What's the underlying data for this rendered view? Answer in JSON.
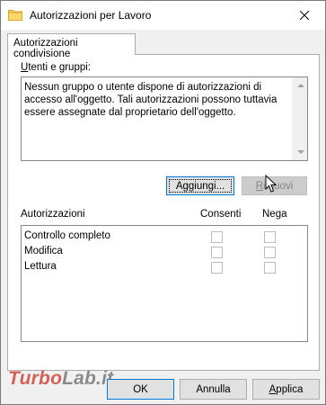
{
  "window": {
    "title": "Autorizzazioni per Lavoro"
  },
  "tab": {
    "label": "Autorizzazioni condivisione"
  },
  "users": {
    "label_prefix": "U",
    "label_rest": "tenti e gruppi:",
    "message": "Nessun gruppo o utente dispone di autorizzazioni di accesso all'oggetto. Tali autorizzazioni possono tuttavia essere assegnate dal proprietario dell'oggetto."
  },
  "buttons": {
    "add_prefix": "A",
    "add_underlined": "g",
    "add_rest": "giungi...",
    "remove_prefix": "",
    "remove_underlined": "R",
    "remove_rest": "imuovi",
    "ok": "OK",
    "cancel": "Annulla",
    "apply_underlined": "A",
    "apply_rest": "pplica"
  },
  "permissions": {
    "header": "Autorizzazioni",
    "allow_header": "Consenti",
    "deny_header": "Nega",
    "rows": [
      {
        "name": "Controllo completo",
        "allow": false,
        "deny": false
      },
      {
        "name": "Modifica",
        "allow": false,
        "deny": false
      },
      {
        "name": "Lettura",
        "allow": false,
        "deny": false
      }
    ]
  },
  "watermark": {
    "part1": "Turbo",
    "part2": "Lab.it"
  },
  "icons": [
    "folder-icon",
    "close-icon",
    "scroll-up-icon",
    "scroll-down-icon",
    "mouse-cursor-icon"
  ],
  "colors": {
    "focus_blue": "#0078d7",
    "disabled_text": "#838383"
  }
}
